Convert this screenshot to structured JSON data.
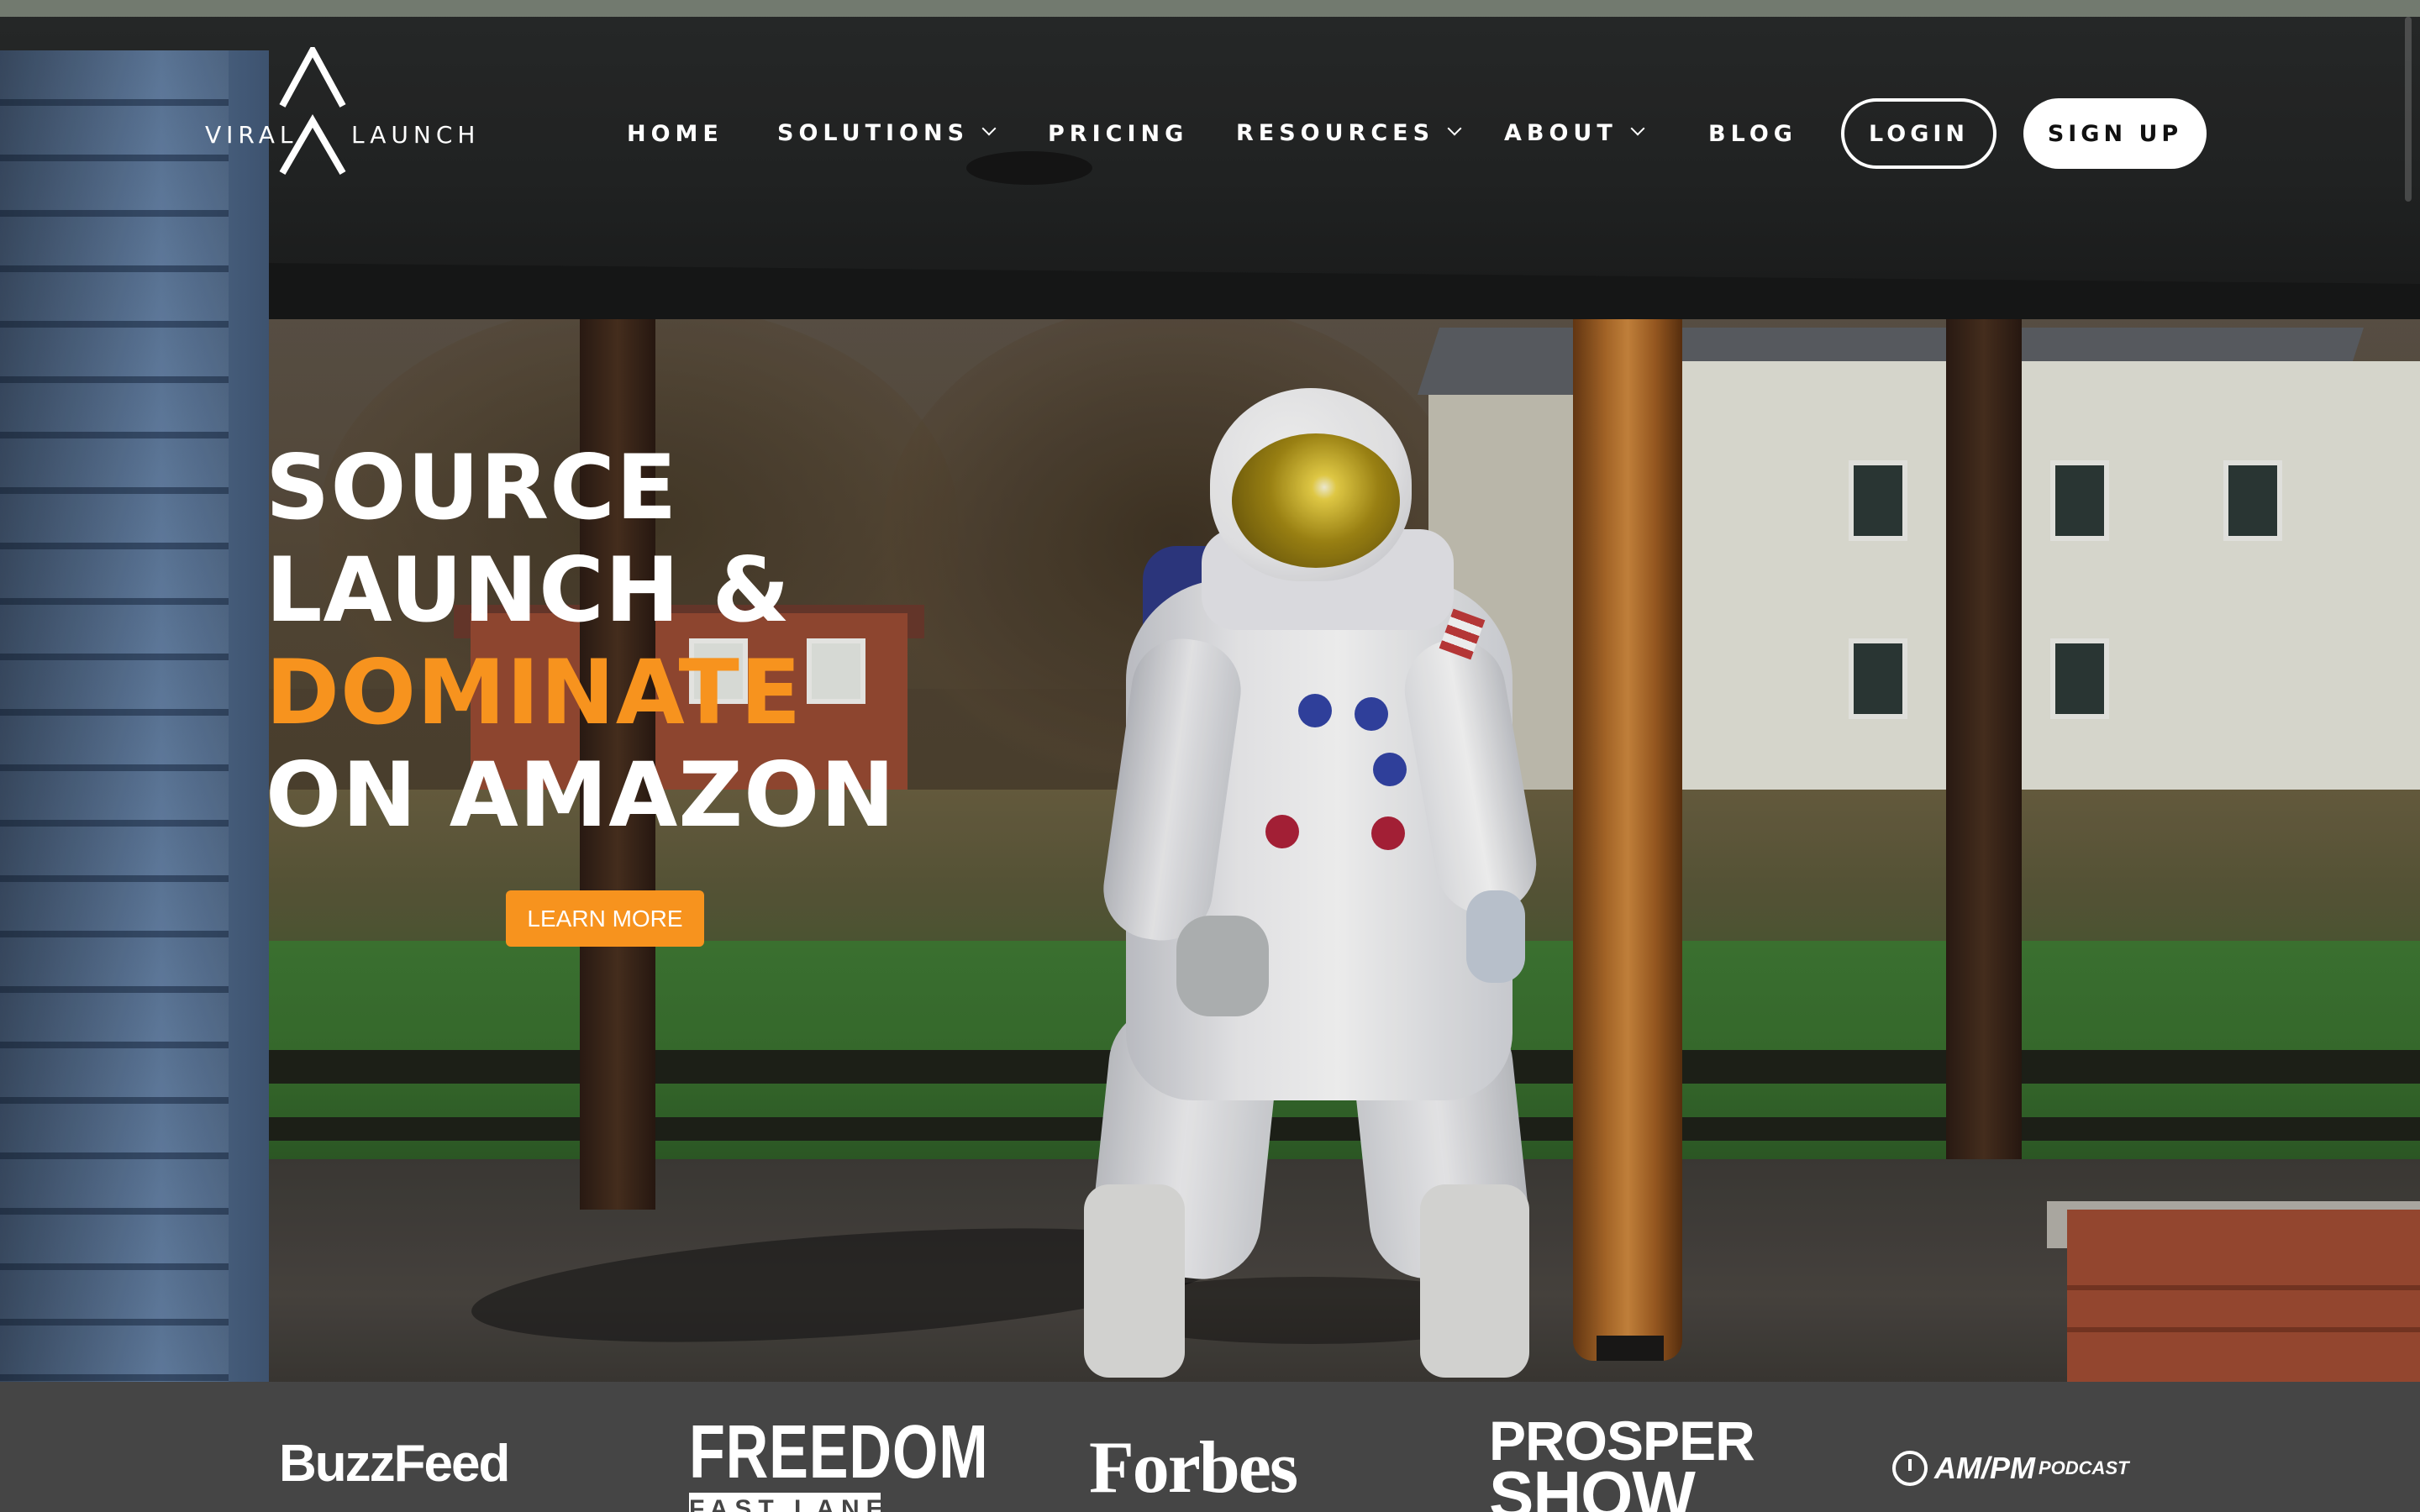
{
  "brand": {
    "logo_word_left": "VIRAL",
    "logo_word_right": "LAUNCH"
  },
  "nav": {
    "items": [
      {
        "label": "HOME",
        "has_dropdown": false
      },
      {
        "label": "SOLUTIONS",
        "has_dropdown": true
      },
      {
        "label": "PRICING",
        "has_dropdown": false
      },
      {
        "label": "RESOURCES",
        "has_dropdown": true
      },
      {
        "label": "ABOUT",
        "has_dropdown": true
      },
      {
        "label": "BLOG",
        "has_dropdown": false
      }
    ],
    "login_label": "LOGIN",
    "signup_label": "SIGN UP"
  },
  "hero": {
    "headline_line1": "SOURCE",
    "headline_line2": "LAUNCH &",
    "headline_line3": "DOMINATE",
    "headline_line4": "ON AMAZON",
    "cta_label": "LEARN MORE"
  },
  "press": {
    "logos": [
      {
        "name": "BuzzFeed"
      },
      {
        "name": "FREEDOM",
        "subtitle": "FAST LANE"
      },
      {
        "name": "Forbes"
      },
      {
        "name": "PROSPER",
        "subtitle": "SHOW"
      },
      {
        "name": "AM/PM",
        "subtitle": "PODCAST"
      }
    ]
  },
  "colors": {
    "accent": "#f7931e",
    "text": "#ffffff",
    "press_bg": "#454545",
    "signup_bg": "#ffffff"
  },
  "icons": [
    "logo-chevron-icon",
    "chevron-down-icon",
    "clock-icon",
    "cart-icon"
  ]
}
